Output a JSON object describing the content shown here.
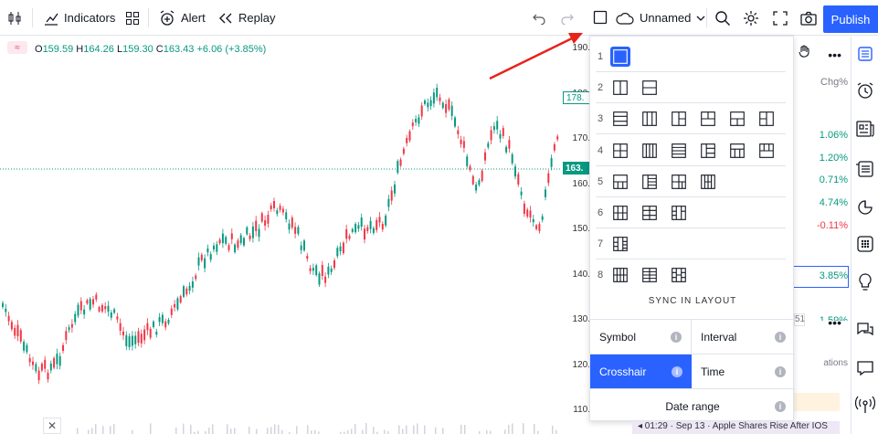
{
  "toolbar": {
    "indicators_label": "Indicators",
    "alert_label": "Alert",
    "replay_label": "Replay",
    "layout_name": "Unnamed",
    "publish_label": "Publish"
  },
  "legend": {
    "badge": "≈",
    "open_label": "O",
    "open": "159.59",
    "high_label": "H",
    "high": "164.26",
    "low_label": "L",
    "low": "159.30",
    "close_label": "C",
    "close": "163.43",
    "change": "+6.06 (+3.85%)"
  },
  "price_axis": {
    "ticks": [
      "190.",
      "180.",
      "170.",
      "160.",
      "150.",
      "140.",
      "130.",
      "120.",
      "110."
    ],
    "high_tag": "178.",
    "last_tag": "163."
  },
  "layout_menu": {
    "rows": [
      {
        "num": "1",
        "count": 1
      },
      {
        "num": "2",
        "count": 2
      },
      {
        "num": "3",
        "count": 6
      },
      {
        "num": "4",
        "count": 6
      },
      {
        "num": "5",
        "count": 4
      },
      {
        "num": "6",
        "count": 3
      },
      {
        "num": "7",
        "count": 1
      },
      {
        "num": "8",
        "count": 3
      }
    ],
    "sync_heading": "SYNC IN LAYOUT",
    "sync": {
      "symbol": "Symbol",
      "interval": "Interval",
      "crosshair": "Crosshair",
      "time": "Time",
      "date_range": "Date range",
      "info": "i"
    }
  },
  "watchlist": {
    "header": "Chg%",
    "rows": [
      {
        "chg": "1.06%",
        "color": "#089981"
      },
      {
        "chg": "1.20%",
        "color": "#089981"
      },
      {
        "chg": "0.71%",
        "color": "#089981"
      },
      {
        "chg": "4.74%",
        "color": "#089981"
      },
      {
        "chg": "-0.11%",
        "color": "#f23645"
      },
      {
        "chg": "3.85%",
        "color": "#089981"
      }
    ],
    "partial": "51",
    "partial_text": "ations"
  },
  "news": {
    "headline": "◂ 01:29 · Sep 13 · Apple Shares Rise After IOS"
  },
  "colors": {
    "accent": "#2962ff",
    "up": "#089981",
    "down": "#f23645",
    "arrow": "#e8231a"
  }
}
